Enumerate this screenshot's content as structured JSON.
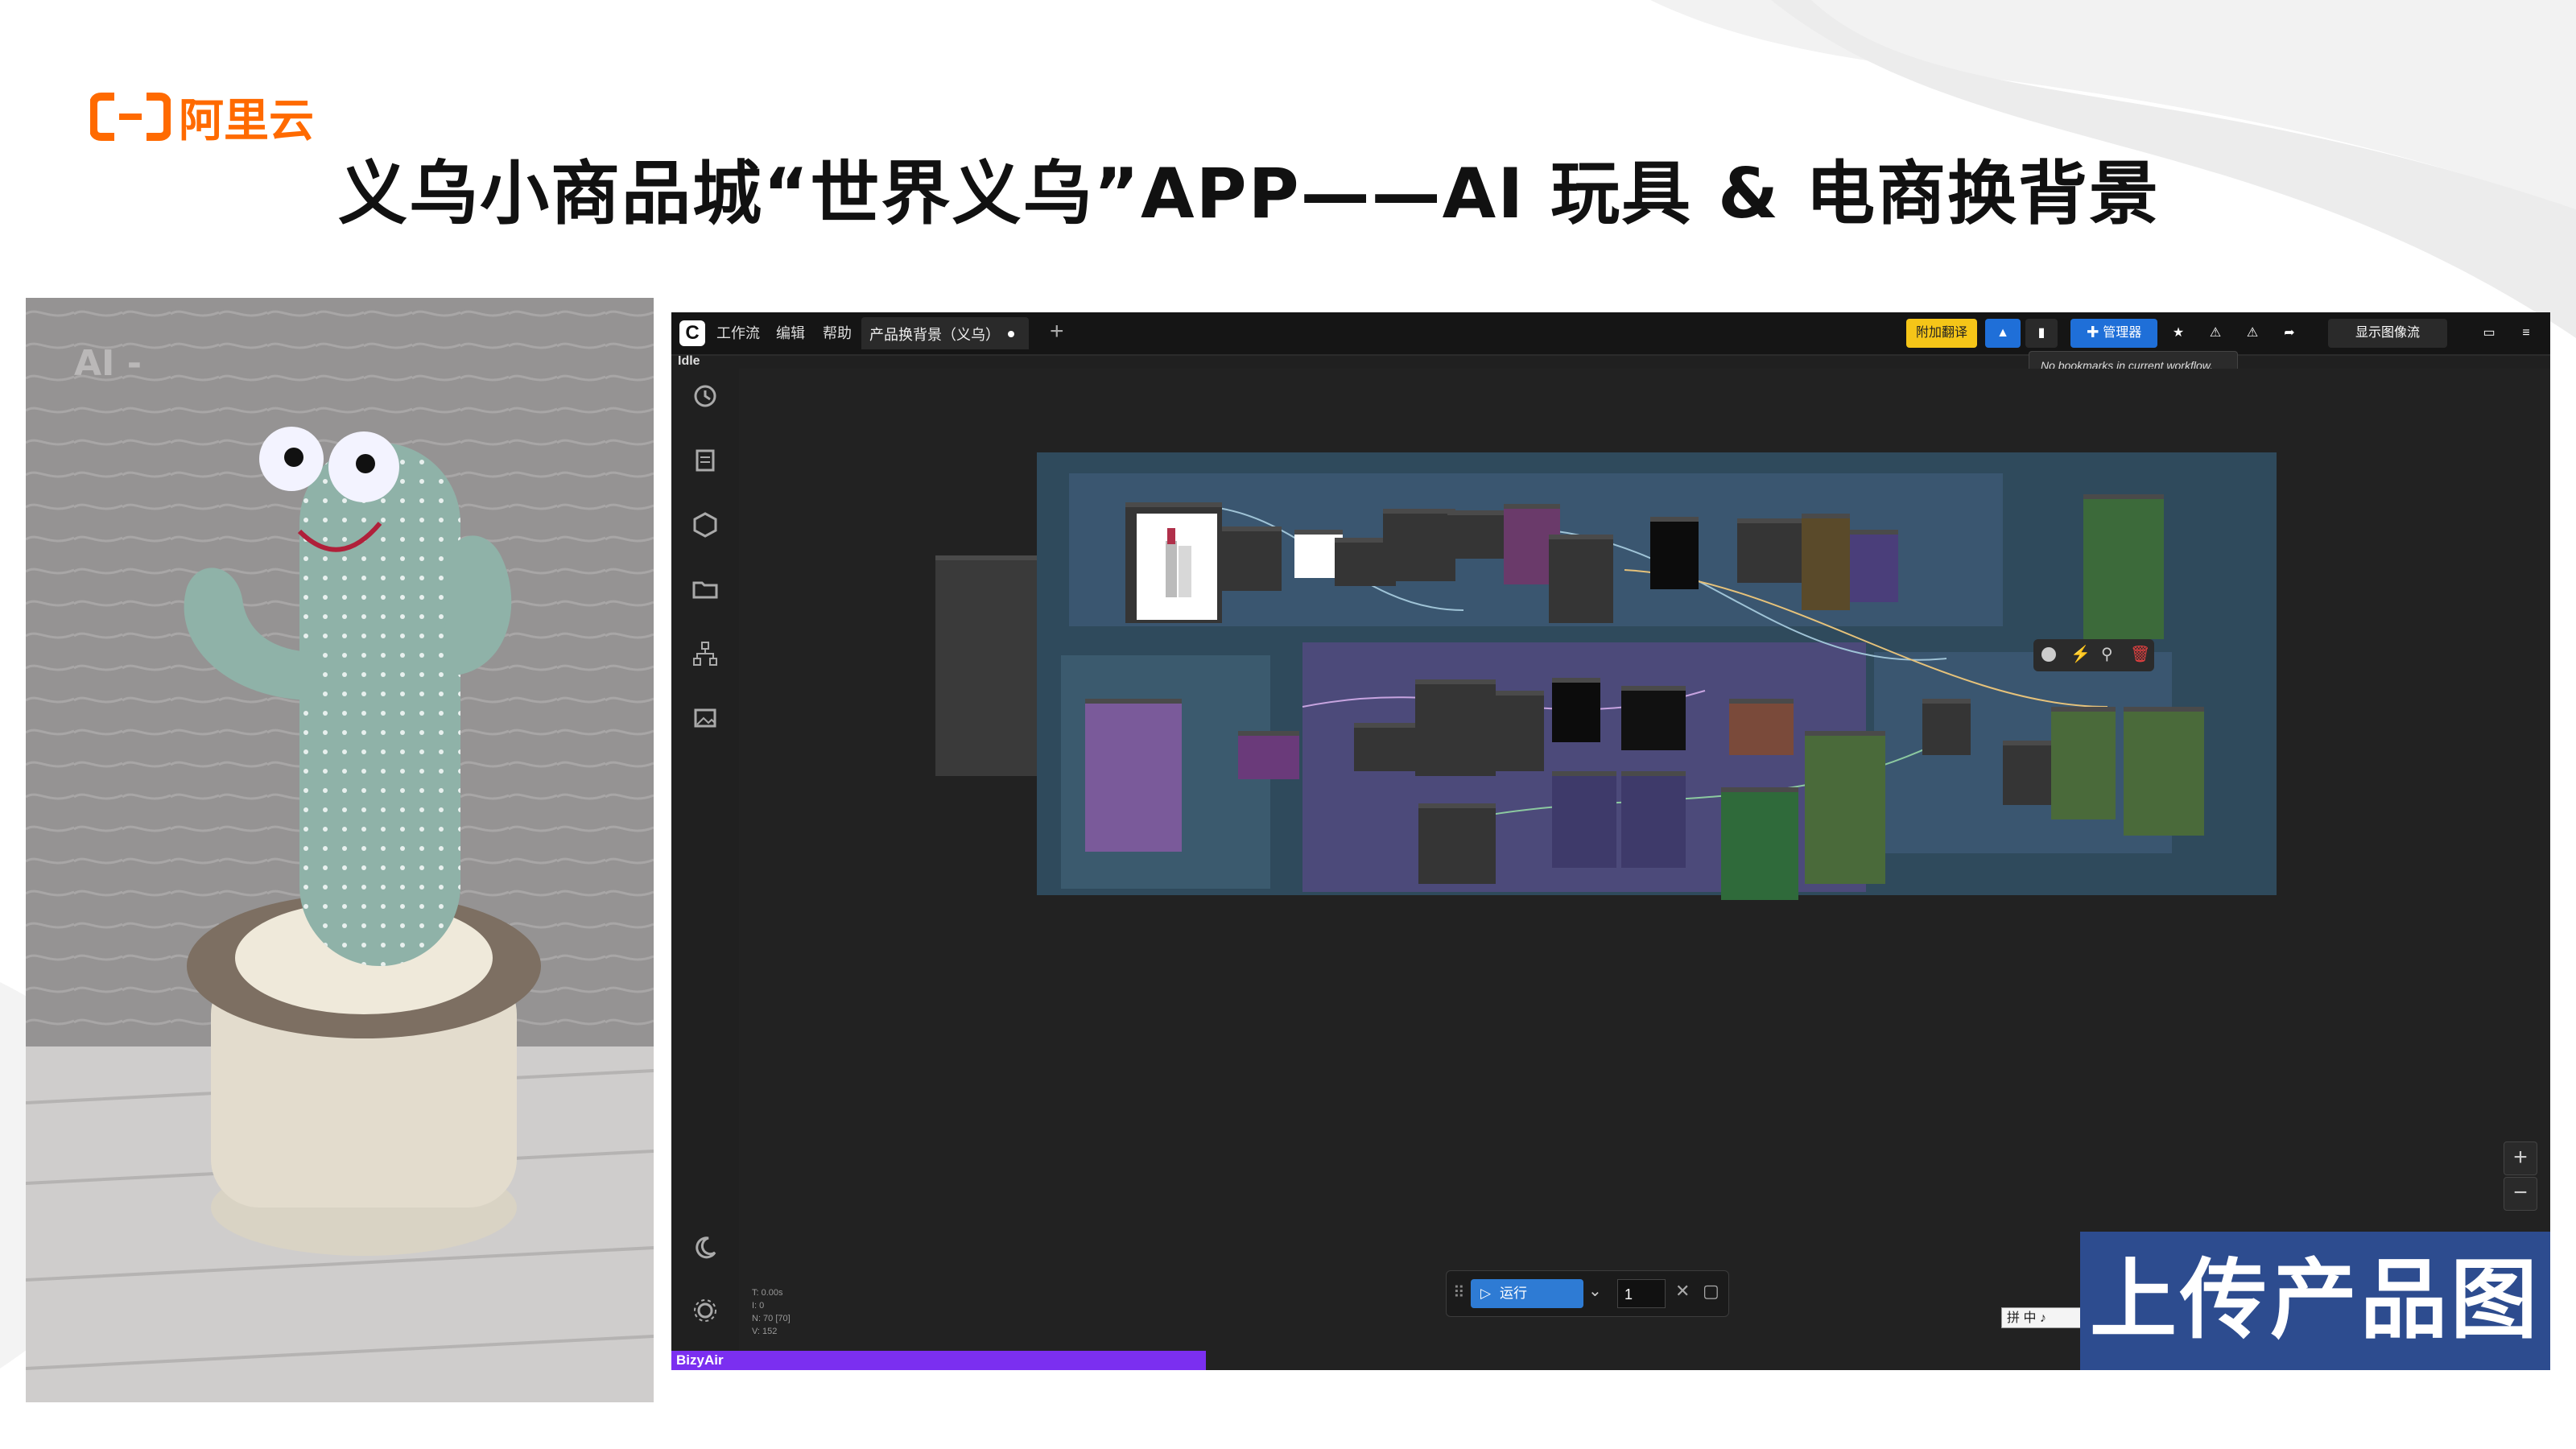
{
  "brand": {
    "logo_text": "阿里云",
    "accent": "#ff6a00"
  },
  "slide": {
    "title": "义乌小商品城“世界义乌”APP——AI 玩具 & 电商换背景",
    "caption": "上传产品图"
  },
  "photo": {
    "watermark": "AI -",
    "subject": "dancing cactus toy"
  },
  "app": {
    "logo": "C",
    "menu": [
      "工作流",
      "编辑",
      "帮助"
    ],
    "workflow_tab": "产品换背景（义乌）",
    "toolbar": {
      "translate_button": "附加翻译",
      "manager_button": "管理器",
      "show_image_button": "显示图像流"
    },
    "tooltip": "No bookmarks in current workflow.",
    "status": "Idle",
    "stats": [
      "T: 0.00s",
      "I: 0",
      "N: 70 [70]",
      "V: 152"
    ],
    "run": {
      "label": "运行",
      "count": "1"
    },
    "bottom_panel": "BizyAir",
    "ime": "拼 中 ♪",
    "colors": {
      "run_blue": "#2e7bd4",
      "manager_blue": "#1f6fd8",
      "translate_yellow": "#f5c518",
      "bizyair_purple": "#7b2ff0"
    },
    "sidebar_icons": [
      "history-icon",
      "queue-icon",
      "model-library-icon",
      "workflows-icon",
      "node-map-icon",
      "image-gallery-icon",
      "theme-moon-icon",
      "settings-gear-icon"
    ]
  }
}
